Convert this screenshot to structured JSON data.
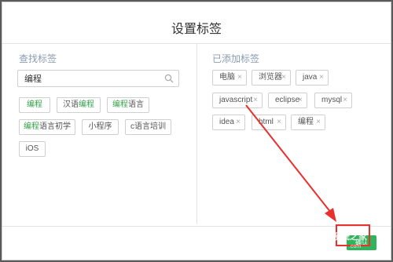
{
  "dialog": {
    "title": "设置标签"
  },
  "search_section": {
    "title": "查找标签",
    "search_value": "编程",
    "results": [
      {
        "before": "",
        "match": "编程",
        "after": ""
      },
      {
        "before": "汉语",
        "match": "编程",
        "after": ""
      },
      {
        "before": "",
        "match": "编程",
        "after": "语言"
      },
      {
        "before": "",
        "match": "编程",
        "after": "语言初学"
      },
      {
        "before": "小程序",
        "match": "",
        "after": ""
      },
      {
        "before": "c语言培训",
        "match": "",
        "after": ""
      },
      {
        "before": "iOS",
        "match": "",
        "after": ""
      }
    ]
  },
  "added_section": {
    "title": "已添加标签",
    "remove_glyph": "×",
    "tags": [
      "电脑",
      "浏览器",
      "java",
      "javascript",
      "eclipse",
      "mysql",
      "idea",
      "html",
      "编程"
    ]
  },
  "footer": {
    "confirm_label": "确认"
  },
  "watermark": {
    "line1": "系统之家",
    "line2": ".com"
  },
  "colors": {
    "match_highlight": "#36a24b",
    "confirm": "#30b35a",
    "annotation": "#e8302c"
  }
}
